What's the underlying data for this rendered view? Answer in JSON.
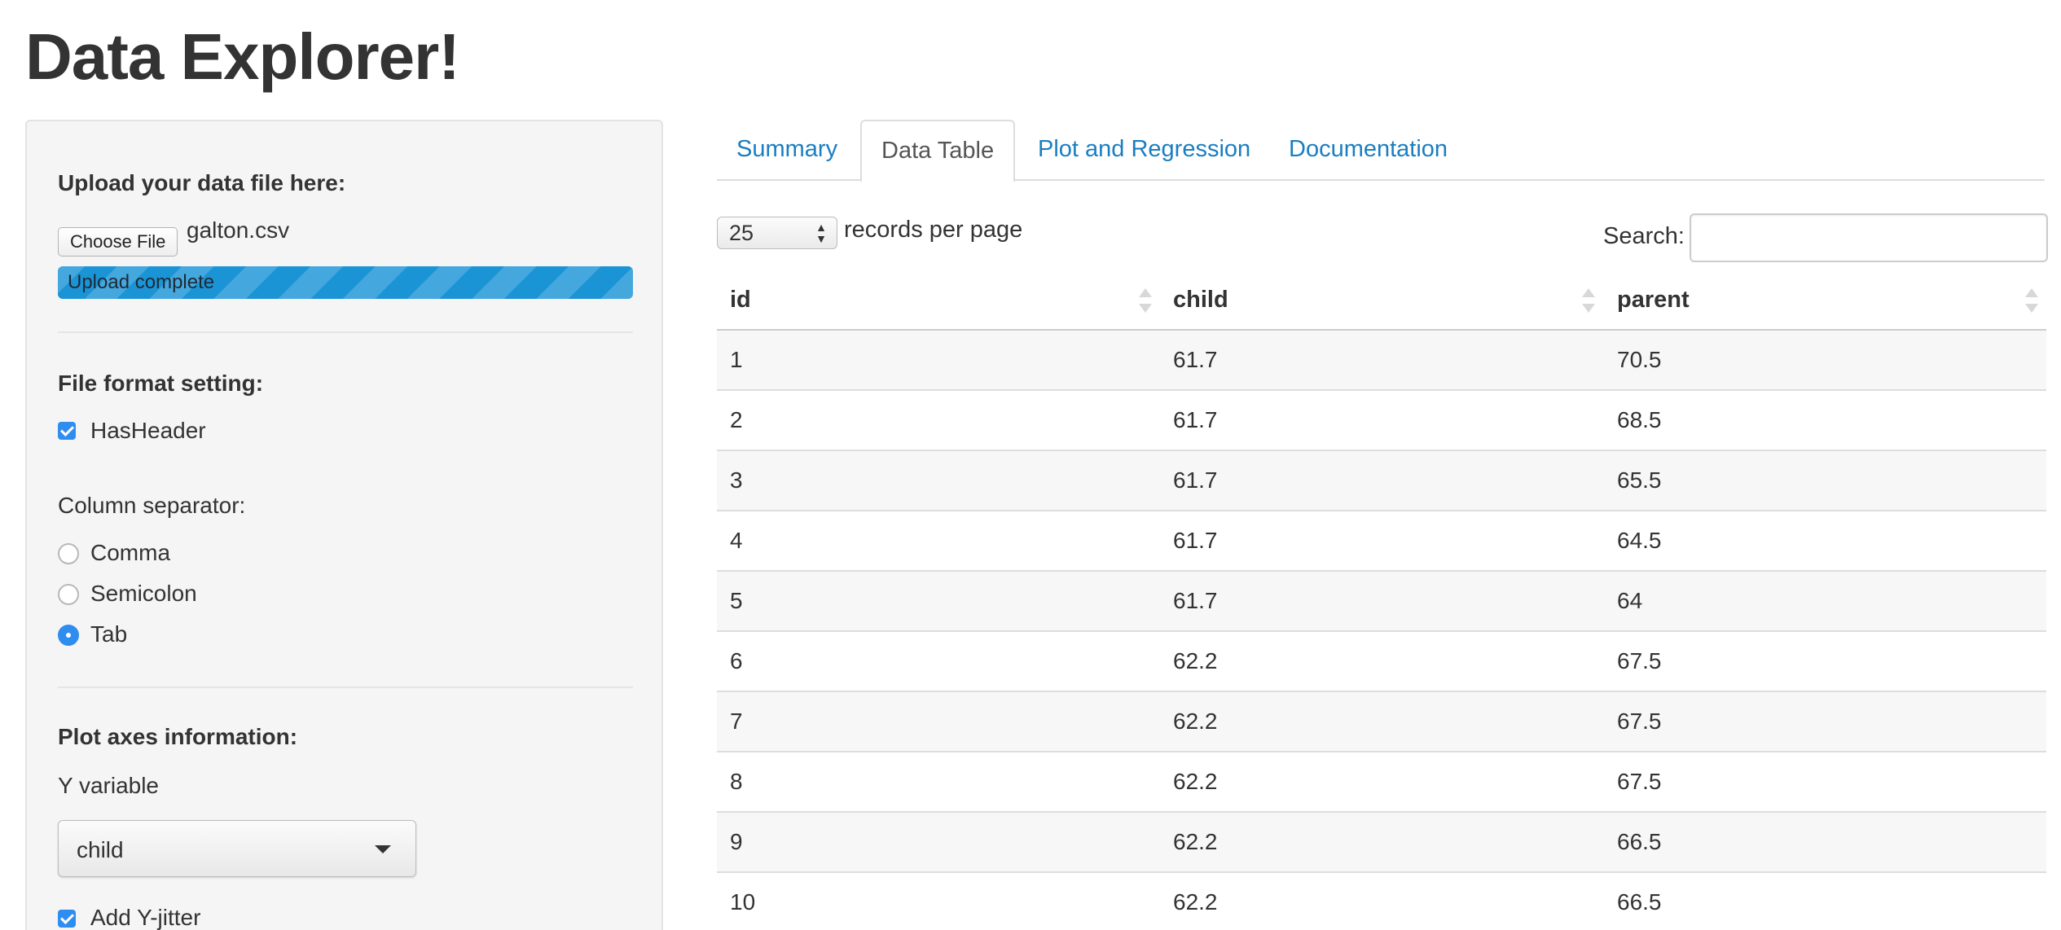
{
  "app_title": "Data Explorer!",
  "sidebar": {
    "upload_label": "Upload your data file here:",
    "choose_file_label": "Choose File",
    "file_name": "galton.csv",
    "upload_status": "Upload complete",
    "upload_progress_percent": 100,
    "format_label": "File format setting:",
    "has_header_label": "HasHeader",
    "has_header_checked": true,
    "separator_label": "Column separator:",
    "separators": [
      {
        "label": "Comma",
        "selected": false
      },
      {
        "label": "Semicolon",
        "selected": false
      },
      {
        "label": "Tab",
        "selected": true
      }
    ],
    "plot_axes_label": "Plot axes information:",
    "y_variable_label": "Y variable",
    "y_variable_value": "child",
    "y_jitter_label": "Add Y-jitter",
    "y_jitter_checked": true
  },
  "tabs": [
    {
      "label": "Summary",
      "active": false
    },
    {
      "label": "Data Table",
      "active": true
    },
    {
      "label": "Plot and Regression",
      "active": false
    },
    {
      "label": "Documentation",
      "active": false
    }
  ],
  "table_controls": {
    "page_length": "25",
    "page_length_text": "records per page",
    "search_label": "Search:",
    "search_value": ""
  },
  "table": {
    "columns": [
      "id",
      "child",
      "parent"
    ],
    "rows": [
      [
        "1",
        "61.7",
        "70.5"
      ],
      [
        "2",
        "61.7",
        "68.5"
      ],
      [
        "3",
        "61.7",
        "65.5"
      ],
      [
        "4",
        "61.7",
        "64.5"
      ],
      [
        "5",
        "61.7",
        "64"
      ],
      [
        "6",
        "62.2",
        "67.5"
      ],
      [
        "7",
        "62.2",
        "67.5"
      ],
      [
        "8",
        "62.2",
        "67.5"
      ],
      [
        "9",
        "62.2",
        "66.5"
      ],
      [
        "10",
        "62.2",
        "66.5"
      ]
    ]
  },
  "colors": {
    "accent": "#2f8df0",
    "link": "#1a7ec1",
    "progress": "#1b94d6"
  }
}
